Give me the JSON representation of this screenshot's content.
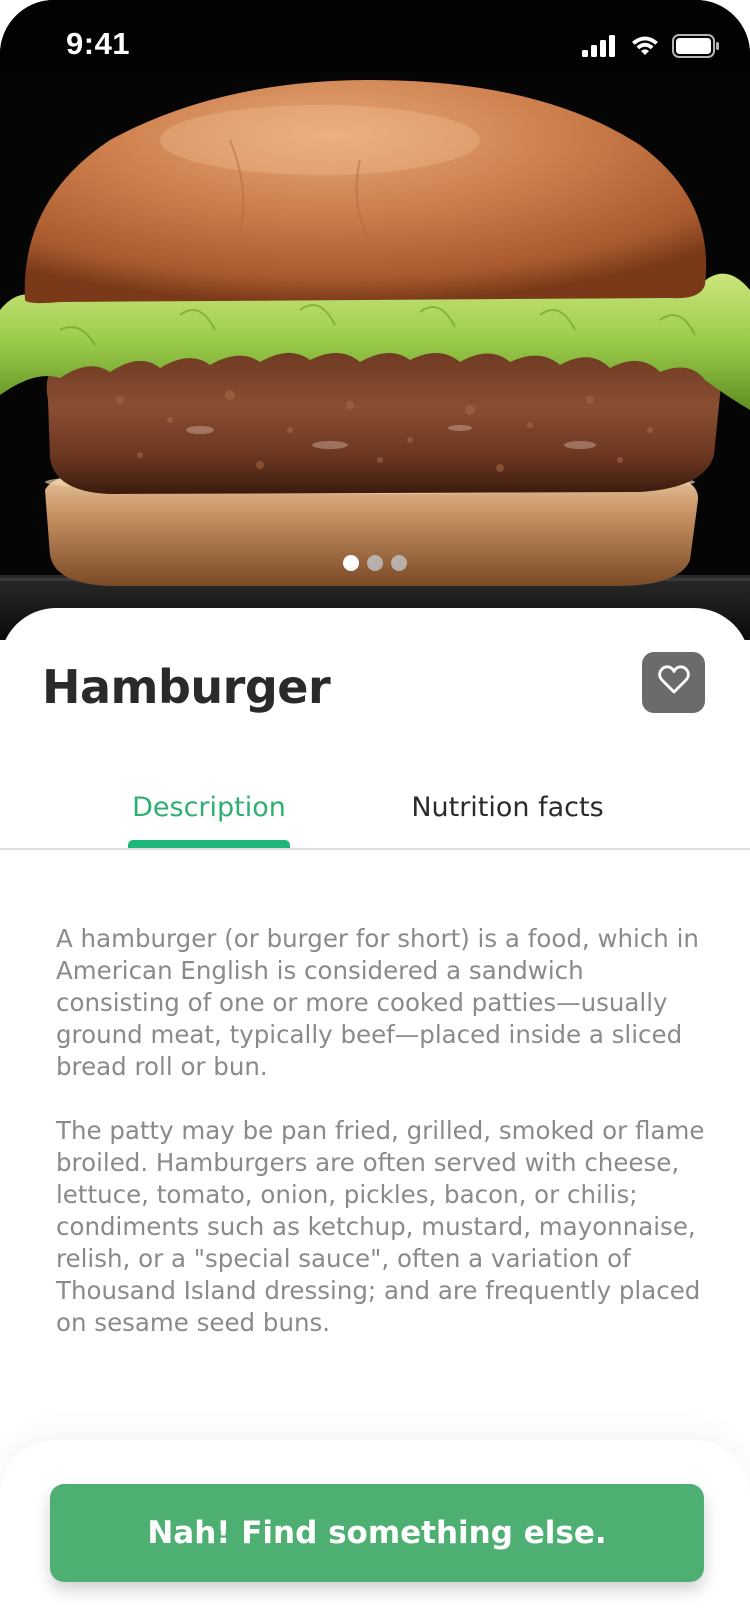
{
  "status_bar": {
    "time": "9:41",
    "icons": [
      "cellular-signal-icon",
      "wifi-icon",
      "battery-icon"
    ]
  },
  "hero": {
    "image": "hamburger-photo",
    "carousel": {
      "total": 3,
      "active_index": 0
    }
  },
  "food": {
    "title": "Hamburger",
    "favorite_icon": "heart-icon"
  },
  "tabs": [
    {
      "label": "Description",
      "active": true
    },
    {
      "label": "Nutrition facts",
      "active": false
    }
  ],
  "description": {
    "paragraphs": [
      "A hamburger (or burger for short) is a food, which in American English is considered a sandwich consisting of one or more cooked patties—usually ground meat, typically beef—placed inside a sliced bread roll or bun.",
      "The patty may be pan fried, grilled, smoked or flame broiled. Hamburgers are often served with cheese, lettuce, tomato, onion, pickles, bacon, or chilis; condiments such as ketchup, mustard, mayonnaise, relish, or a \"special sauce\", often a variation of Thousand Island dressing; and are frequently placed on sesame seed buns."
    ]
  },
  "cta": {
    "label": "Nah! Find something else."
  },
  "colors": {
    "accent_green": "#2fb072",
    "tab_underline": "#1eb57a",
    "cta_green": "#4daf72",
    "favorite_bg": "#6b6b6b",
    "body_text": "#8a8a8a",
    "title_text": "#2a2a2a"
  }
}
